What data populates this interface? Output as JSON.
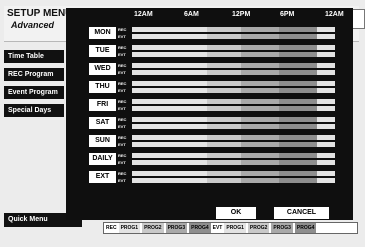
{
  "app": {
    "title": "SETUP MENU",
    "subtitle": "Advanced"
  },
  "sidebar": {
    "items": [
      "Time Table",
      "REC Program",
      "Event Program",
      "Special Days"
    ]
  },
  "quick_menu": "Quick Menu",
  "timeline": [
    "12AM",
    "6AM",
    "12PM",
    "6PM",
    "12AM"
  ],
  "rows": [
    {
      "day": "MON"
    },
    {
      "day": "TUE"
    },
    {
      "day": "WED"
    },
    {
      "day": "THU"
    },
    {
      "day": "FRI"
    },
    {
      "day": "SAT"
    },
    {
      "day": "SUN"
    },
    {
      "day": "DAILY"
    },
    {
      "day": "EXT"
    }
  ],
  "tags": {
    "rec": "REC",
    "evt": "EVT"
  },
  "buttons": {
    "ok": "OK",
    "cancel": "CANCEL"
  },
  "legend": {
    "rec_label": "REC",
    "evt_label": "EVT",
    "rec_items": [
      "PROG1",
      "PROG2",
      "PROG3",
      "PROG4"
    ],
    "evt_items": [
      "PROG1",
      "PROG2",
      "PROG3",
      "PROG4"
    ]
  },
  "colors": {
    "prog1": "#e3e3e3",
    "prog2": "#c9c9c9",
    "prog3": "#a9a9a9",
    "prog4": "#8e8e8e"
  }
}
